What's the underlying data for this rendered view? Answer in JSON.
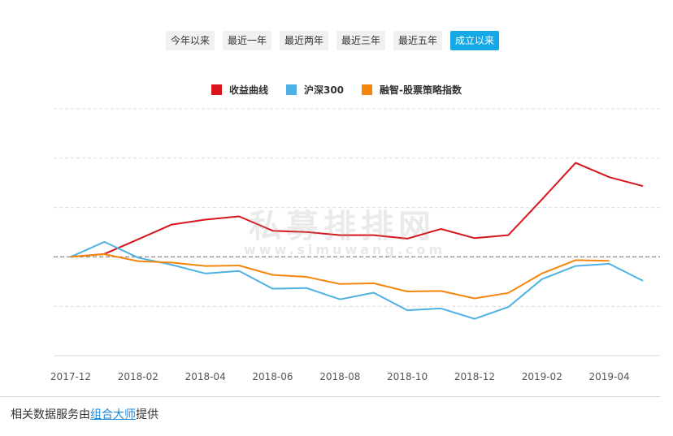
{
  "range_buttons": [
    {
      "label": "今年以来",
      "active": false
    },
    {
      "label": "最近一年",
      "active": false
    },
    {
      "label": "最近两年",
      "active": false
    },
    {
      "label": "最近三年",
      "active": false
    },
    {
      "label": "最近五年",
      "active": false
    },
    {
      "label": "成立以来",
      "active": true
    }
  ],
  "watermark": {
    "text_cn": "私募排排网",
    "text_en": "www.simuwang.com"
  },
  "footer": {
    "prefix": "相关数据服务由",
    "link": "组合大师",
    "suffix": "提供"
  },
  "chart_data": {
    "type": "line",
    "title": "",
    "xlabel": "",
    "ylabel": "",
    "x_ticks": [
      "2017-12",
      "2018-02",
      "2018-04",
      "2018-06",
      "2018-08",
      "2018-10",
      "2018-12",
      "2019-02",
      "2019-04"
    ],
    "x": [
      "2017-12",
      "2018-01",
      "2018-02",
      "2018-03",
      "2018-04",
      "2018-05",
      "2018-06",
      "2018-07",
      "2018-08",
      "2018-09",
      "2018-10",
      "2018-11",
      "2018-12",
      "2019-01",
      "2019-02",
      "2019-03",
      "2019-04",
      "2019-05"
    ],
    "ylim": [
      -40,
      60
    ],
    "y_tick_values": [
      -40,
      -20,
      0,
      20,
      40,
      60
    ],
    "y_tick_labels_visible": false,
    "zero_line": "dashed",
    "grid": "horizontal-dashed",
    "legend": "top-center",
    "series": [
      {
        "name": "收益曲线",
        "color": "#d7151b",
        "values": [
          0,
          1.2,
          7.1,
          13.1,
          15.1,
          16.4,
          10.6,
          10.1,
          8.8,
          8.8,
          7.4,
          11.3,
          7.6,
          8.8,
          23.3,
          38.1,
          32.3,
          28.7
        ]
      },
      {
        "name": "沪深300",
        "color": "#4fb1e3",
        "values": [
          0,
          6.1,
          -0.3,
          -3.2,
          -6.7,
          -5.7,
          -12.9,
          -12.6,
          -17.2,
          -14.5,
          -21.6,
          -20.9,
          -25.1,
          -20.3,
          -9.0,
          -3.7,
          -2.8,
          -9.7
        ]
      },
      {
        "name": "融智-股票策略指数",
        "color": "#f5860c",
        "values": [
          0,
          1.1,
          -1.7,
          -2.3,
          -3.7,
          -3.5,
          -7.3,
          -8.1,
          -11.0,
          -10.7,
          -14.0,
          -13.8,
          -16.8,
          -14.6,
          -6.7,
          -1.3,
          -1.6,
          null
        ]
      }
    ]
  }
}
